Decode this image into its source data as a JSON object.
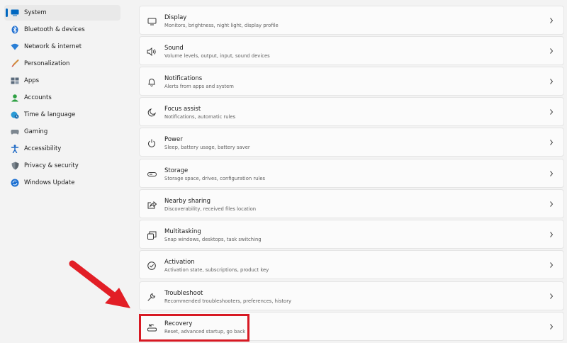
{
  "sidebar": {
    "items": [
      {
        "label": "System",
        "icon": "monitor-icon",
        "selected": true
      },
      {
        "label": "Bluetooth & devices",
        "icon": "bluetooth-icon"
      },
      {
        "label": "Network & internet",
        "icon": "wifi-icon"
      },
      {
        "label": "Personalization",
        "icon": "brush-icon"
      },
      {
        "label": "Apps",
        "icon": "apps-icon"
      },
      {
        "label": "Accounts",
        "icon": "person-icon"
      },
      {
        "label": "Time & language",
        "icon": "globe-clock-icon"
      },
      {
        "label": "Gaming",
        "icon": "gamepad-icon"
      },
      {
        "label": "Accessibility",
        "icon": "accessibility-icon"
      },
      {
        "label": "Privacy & security",
        "icon": "shield-icon"
      },
      {
        "label": "Windows Update",
        "icon": "windows-update-icon"
      }
    ]
  },
  "settings": [
    {
      "title": "Display",
      "subtitle": "Monitors, brightness, night light, display profile",
      "icon": "display-icon"
    },
    {
      "title": "Sound",
      "subtitle": "Volume levels, output, input, sound devices",
      "icon": "speaker-icon"
    },
    {
      "title": "Notifications",
      "subtitle": "Alerts from apps and system",
      "icon": "bell-icon"
    },
    {
      "title": "Focus assist",
      "subtitle": "Notifications, automatic rules",
      "icon": "moon-icon"
    },
    {
      "title": "Power",
      "subtitle": "Sleep, battery usage, battery saver",
      "icon": "power-icon"
    },
    {
      "title": "Storage",
      "subtitle": "Storage space, drives, configuration rules",
      "icon": "storage-icon"
    },
    {
      "title": "Nearby sharing",
      "subtitle": "Discoverability, received files location",
      "icon": "share-icon"
    },
    {
      "title": "Multitasking",
      "subtitle": "Snap windows, desktops, task switching",
      "icon": "multitasking-icon"
    },
    {
      "title": "Activation",
      "subtitle": "Activation state, subscriptions, product key",
      "icon": "check-circle-icon"
    },
    {
      "title": "Troubleshoot",
      "subtitle": "Recommended troubleshooters, preferences, history",
      "icon": "wrench-icon"
    },
    {
      "title": "Recovery",
      "subtitle": "Reset, advanced startup, go back",
      "icon": "recovery-icon"
    }
  ],
  "colors": {
    "accent": "#0067c0",
    "highlight": "#d71923"
  }
}
